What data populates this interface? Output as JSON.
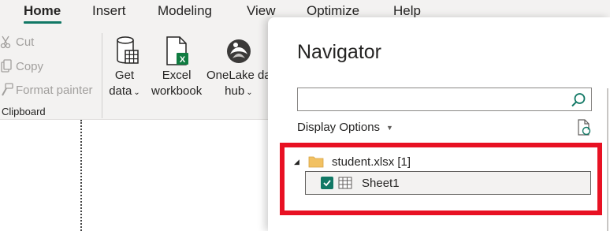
{
  "ribbon_tabs": [
    {
      "label": "Home",
      "active": true
    },
    {
      "label": "Insert"
    },
    {
      "label": "Modeling"
    },
    {
      "label": "View"
    },
    {
      "label": "Optimize"
    },
    {
      "label": "Help"
    }
  ],
  "clipboard": {
    "cut": "Cut",
    "copy": "Copy",
    "format_painter": "Format painter",
    "group_label": "Clipboard"
  },
  "data_group": {
    "get_data": {
      "line1": "Get",
      "line2": "data",
      "icon": "database-icon"
    },
    "excel_workbook": {
      "line1": "Excel",
      "line2": "workbook",
      "icon": "excel-icon"
    },
    "onelake": {
      "line1": "OneLake da",
      "line2": "hub",
      "icon": "onelake-icon"
    }
  },
  "navigator": {
    "title": "Navigator",
    "search_value": "",
    "display_options": "Display Options",
    "file_node": "student.xlsx [1]",
    "sheet_node": "Sheet1",
    "sheet_checked": true
  },
  "colors": {
    "accent": "#117865",
    "highlight_border": "#e81123",
    "ribbon_bg": "#f3f2f1"
  }
}
